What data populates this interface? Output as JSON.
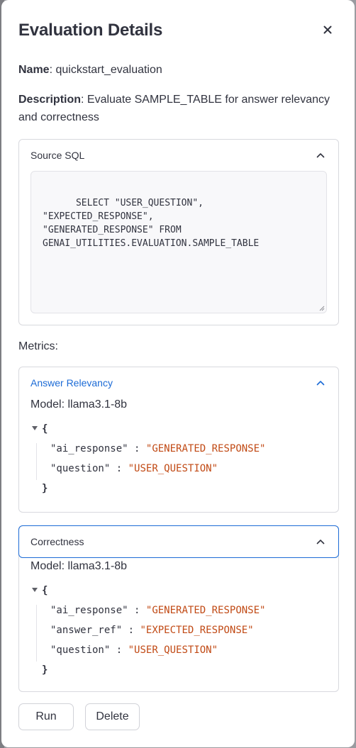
{
  "dialog": {
    "title": "Evaluation Details",
    "name_label": "Name",
    "name_value": "quickstart_evaluation",
    "description_label": "Description",
    "description_value": "Evaluate SAMPLE_TABLE for answer relevancy and correctness"
  },
  "source_sql": {
    "label": "Source SQL",
    "query": "SELECT \"USER_QUESTION\", \"EXPECTED_RESPONSE\",\n\"GENERATED_RESPONSE\" FROM\nGENAI_UTILITIES.EVALUATION.SAMPLE_TABLE"
  },
  "metrics": {
    "label": "Metrics:",
    "items": [
      {
        "title": "Answer Relevancy",
        "title_color": "#1c6bd6",
        "model": "Model: llama3.1-8b",
        "params": [
          {
            "key": "\"ai_response\"",
            "value": "\"GENERATED_RESPONSE\""
          },
          {
            "key": "\"question\"",
            "value": "\"USER_QUESTION\""
          }
        ]
      },
      {
        "title": "Correctness",
        "model": "Model: llama3.1-8b",
        "params": [
          {
            "key": "\"ai_response\"",
            "value": "\"GENERATED_RESPONSE\""
          },
          {
            "key": "\"answer_ref\"",
            "value": "\"EXPECTED_RESPONSE\""
          },
          {
            "key": "\"question\"",
            "value": "\"USER_QUESTION\""
          }
        ]
      }
    ]
  },
  "json_syntax": {
    "open_brace": "{",
    "close_brace": "}",
    "separator": ":"
  },
  "actions": {
    "run_label": "Run",
    "delete_label": "Delete"
  },
  "colors": {
    "accent": "#1c6bd6",
    "json_string": "#c14a15",
    "text": "#31333f"
  }
}
